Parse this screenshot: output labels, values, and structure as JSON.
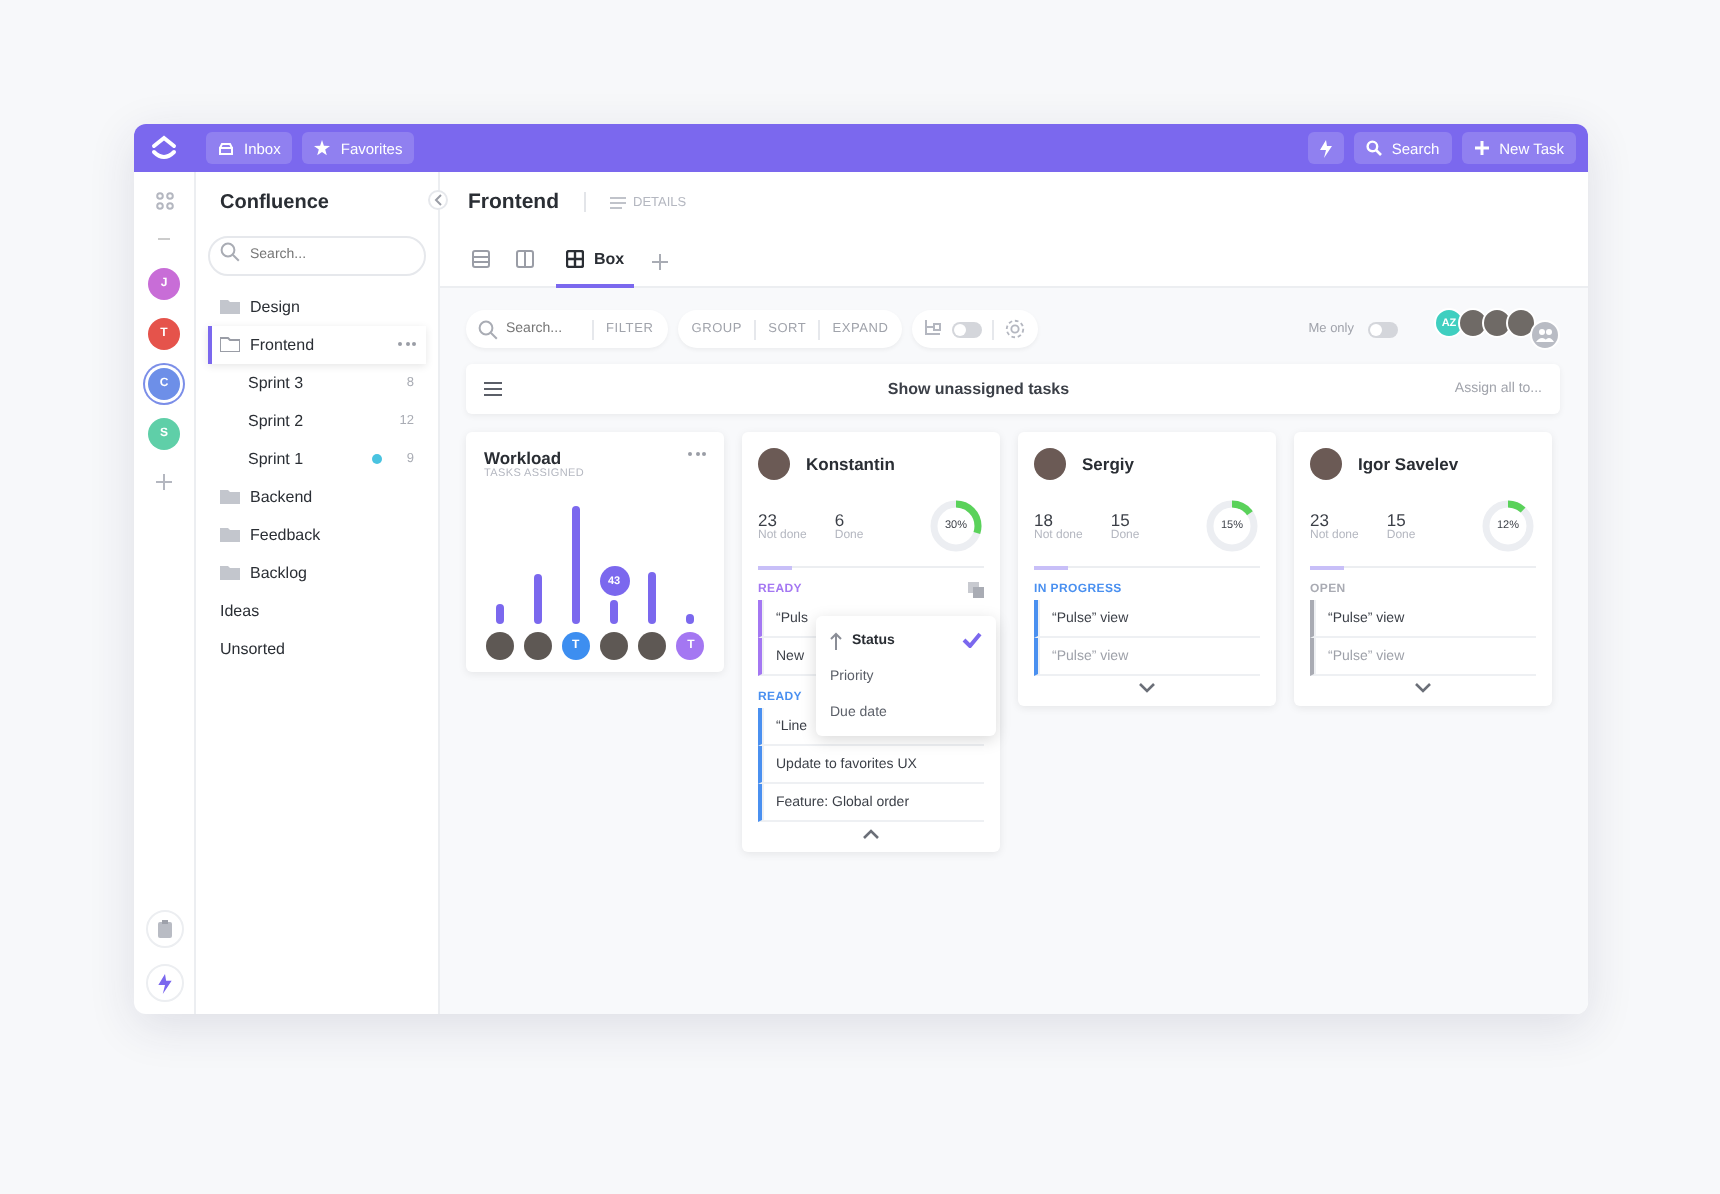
{
  "topbar": {
    "inbox": "Inbox",
    "favorites": "Favorites",
    "search": "Search",
    "new_task": "New Task"
  },
  "rail": {
    "avatars": [
      {
        "letter": "J",
        "color": "#c86dd7",
        "selected": false
      },
      {
        "letter": "T",
        "color": "#e5534b",
        "selected": false
      },
      {
        "letter": "C",
        "color": "#6d8fe8",
        "selected": true
      },
      {
        "letter": "S",
        "color": "#5fcfa8",
        "selected": false
      }
    ]
  },
  "sidebar": {
    "title": "Confluence",
    "search_placeholder": "Search...",
    "items": [
      {
        "kind": "folder",
        "label": "Design",
        "selected": false
      },
      {
        "kind": "folder",
        "label": "Frontend",
        "selected": true,
        "children": [
          {
            "label": "Sprint 3",
            "count": "8"
          },
          {
            "label": "Sprint 2",
            "count": "12"
          },
          {
            "label": "Sprint 1",
            "count": "9",
            "color": "#49c3e0"
          }
        ]
      },
      {
        "kind": "folder",
        "label": "Backend",
        "selected": false
      },
      {
        "kind": "folder",
        "label": "Feedback",
        "selected": false
      },
      {
        "kind": "folder",
        "label": "Backlog",
        "selected": false
      },
      {
        "kind": "plain",
        "label": "Ideas",
        "selected": false
      },
      {
        "kind": "plain",
        "label": "Unsorted",
        "selected": false
      }
    ]
  },
  "header": {
    "title": "Frontend",
    "details": "DETAILS",
    "views": [
      {
        "kind": "list",
        "selected": false
      },
      {
        "kind": "board",
        "selected": false
      },
      {
        "kind": "box",
        "label": "Box",
        "selected": true
      }
    ]
  },
  "toolbar": {
    "search_placeholder": "Search...",
    "filter": "FILTER",
    "group": "GROUP",
    "sort": "SORT",
    "expand": "EXPAND",
    "me_only": "Me only",
    "me_only_on": false,
    "subtasks_on": false,
    "team": [
      {
        "kind": "initials",
        "text": "AZ",
        "color": "#3fcfc0"
      },
      {
        "kind": "photo"
      },
      {
        "kind": "photo"
      },
      {
        "kind": "photo"
      },
      {
        "kind": "group"
      }
    ]
  },
  "banner": {
    "text": "Show unassigned tasks",
    "action": "Assign all to..."
  },
  "workload": {
    "title": "Workload",
    "subtitle": "TASKS ASSIGNED",
    "badge": "43",
    "people": [
      {
        "kind": "photo"
      },
      {
        "kind": "photo"
      },
      {
        "kind": "initial",
        "text": "T",
        "color": "#3d8ef0"
      },
      {
        "kind": "photo"
      },
      {
        "kind": "photo"
      },
      {
        "kind": "initial",
        "text": "T",
        "color": "#a477f2"
      }
    ]
  },
  "people": [
    {
      "name": "Konstantin",
      "not_done": "23",
      "not_done_label": "Not done",
      "done": "6",
      "done_label": "Done",
      "percent": "30%",
      "level": 0.3,
      "progress": {
        "level": 0.15
      },
      "expanded": true,
      "groups": [
        {
          "status": "READY",
          "color": "#a477f2",
          "tasks": [
            {
              "text": "“Puls",
              "faded": false
            },
            {
              "text": "New",
              "faded": false
            }
          ]
        },
        {
          "status": "READY",
          "color": "#4a90f0",
          "tasks": [
            {
              "text": "“Line",
              "faded": false
            },
            {
              "text": "Update to favorites UX",
              "faded": false
            },
            {
              "text": "Feature: Global order",
              "faded": false
            }
          ]
        }
      ],
      "menu": [
        {
          "label": "Status",
          "selected": true
        },
        {
          "label": "Priority",
          "selected": false
        },
        {
          "label": "Due date",
          "selected": false
        }
      ]
    },
    {
      "name": "Sergiy",
      "not_done": "18",
      "not_done_label": "Not done",
      "done": "15",
      "done_label": "Done",
      "percent": "15%",
      "level": 0.15,
      "progress": {
        "level": 0.15
      },
      "expanded": false,
      "groups": [
        {
          "status": "IN PROGRESS",
          "color": "#4a90f0",
          "tasks": [
            {
              "text": "“Pulse” view",
              "faded": false
            },
            {
              "text": "“Pulse” view",
              "faded": true
            }
          ]
        }
      ]
    },
    {
      "name": "Igor Savelev",
      "not_done": "23",
      "not_done_label": "Not done",
      "done": "15",
      "done_label": "Done",
      "percent": "12%",
      "level": 0.12,
      "progress": {
        "level": 0.15
      },
      "expanded": false,
      "groups": [
        {
          "status": "OPEN",
          "color": "#a9abb3",
          "tasks": [
            {
              "text": "“Pulse” view",
              "faded": false
            },
            {
              "text": "“Pulse” view",
              "faded": true
            }
          ]
        }
      ]
    }
  ]
}
